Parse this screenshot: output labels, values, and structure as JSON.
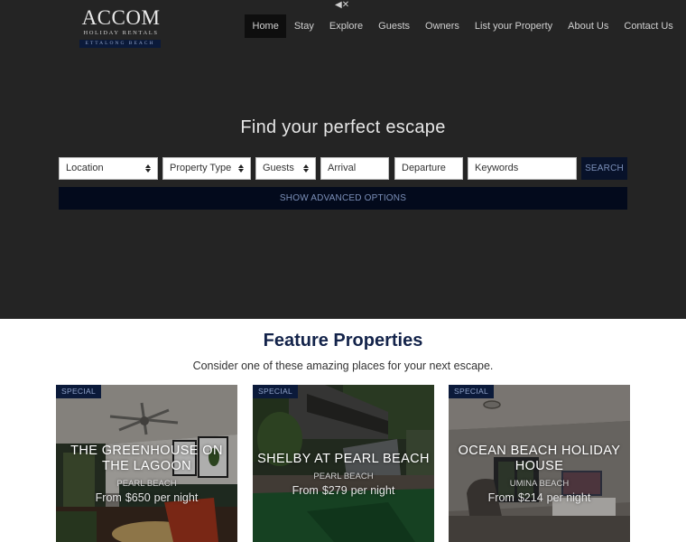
{
  "brand": {
    "name": "ACCOM",
    "tagline": "HOLIDAY RENTALS",
    "location": "ETTALONG BEACH"
  },
  "audio": {
    "mute_icon": "speaker-muted-icon",
    "glyph": "◀✕"
  },
  "nav": {
    "items": [
      {
        "label": "Home",
        "active": true
      },
      {
        "label": "Stay"
      },
      {
        "label": "Explore"
      },
      {
        "label": "Guests"
      },
      {
        "label": "Owners"
      },
      {
        "label": "List your Property"
      },
      {
        "label": "About Us"
      },
      {
        "label": "Contact Us"
      }
    ]
  },
  "hero": {
    "title": "Find your perfect escape"
  },
  "search": {
    "location": {
      "value": "Location"
    },
    "property_type": {
      "value": "Property Type"
    },
    "guests": {
      "value": "Guests"
    },
    "arrival": {
      "placeholder": "Arrival"
    },
    "departure": {
      "placeholder": "Departure"
    },
    "keywords": {
      "placeholder": "Keywords"
    },
    "search_label": "SEARCH",
    "advanced_label": "SHOW ADVANCED OPTIONS"
  },
  "featured": {
    "title": "Feature Properties",
    "subtitle": "Consider one of these amazing places for your next escape.",
    "cards": [
      {
        "badge": "SPECIAL",
        "name": "THE GREENHOUSE ON THE LAGOON",
        "location": "PEARL BEACH",
        "from": "From",
        "price": "$650",
        "per": "per night"
      },
      {
        "badge": "SPECIAL",
        "name": "SHELBY AT PEARL BEACH",
        "location": "PEARL BEACH",
        "from": "From",
        "price": "$279",
        "per": "per night"
      },
      {
        "badge": "SPECIAL",
        "name": "OCEAN BEACH HOLIDAY HOUSE",
        "location": "UMINA BEACH",
        "from": "From",
        "price": "$214",
        "per": "per night"
      }
    ]
  },
  "colors": {
    "hero_bg": "#242424",
    "navy": "#0b1a3a",
    "heading": "#13234a",
    "button_text": "#7b8fb8"
  }
}
